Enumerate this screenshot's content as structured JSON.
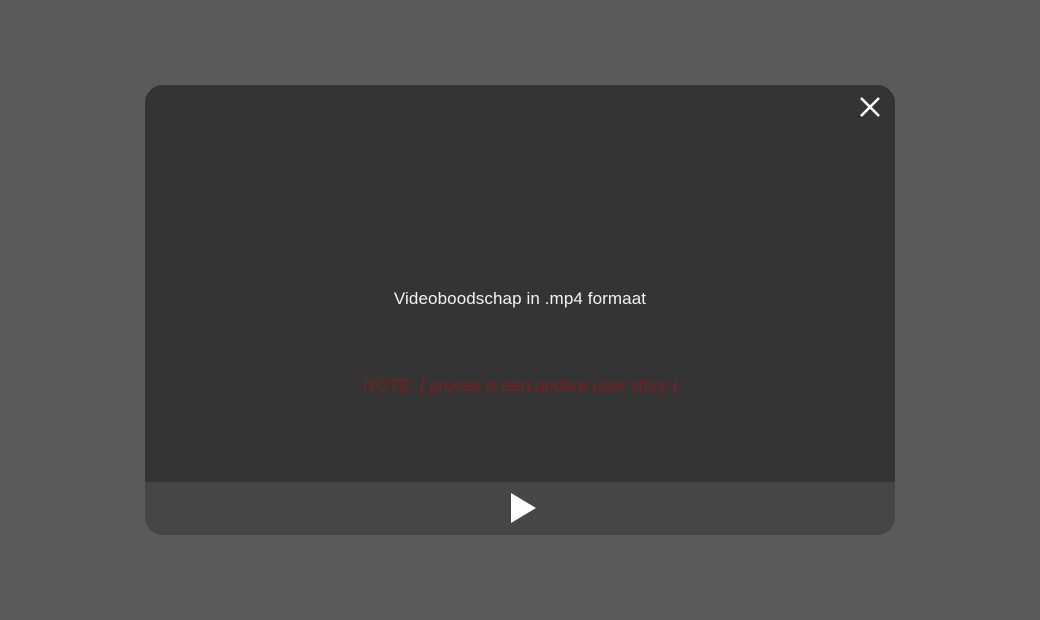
{
  "video_modal": {
    "caption": "Videoboodschap in .mp4 formaat",
    "note": "NOTE: [ proces is een andere user story ]",
    "close_icon": "close-icon",
    "play_icon": "play-icon"
  },
  "colors": {
    "page_background": "#5a5a5a",
    "video_background": "#343434",
    "control_bar": "#464646",
    "caption_text": "#f2f2f2",
    "note_text": "#7a1f22"
  }
}
